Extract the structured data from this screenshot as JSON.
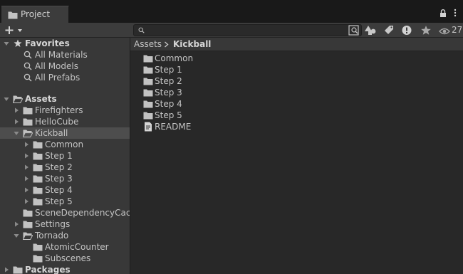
{
  "window": {
    "tab_label": "Project",
    "hidden_count": "27"
  },
  "icons": {
    "tab": "folder-icon",
    "create": "plus-icon",
    "search": "search-icon",
    "scope": "search-scope-icon",
    "type_filter": "shapes-icon",
    "label_filter": "tag-icon",
    "log": "info-icon",
    "favorites": "star-icon",
    "visibility": "eye-icon"
  },
  "colors": {
    "background": "#282828",
    "panel": "#383838",
    "selection": "#4d4d4d",
    "text": "#c4c4c4"
  },
  "tree": [
    {
      "label": "Favorites",
      "bold": true,
      "icon": "star"
    },
    {
      "label": "All Materials",
      "icon": "search"
    },
    {
      "label": "All Models",
      "icon": "search"
    },
    {
      "label": "All Prefabs",
      "icon": "search"
    },
    {
      "label": "Assets",
      "bold": true,
      "icon": "folder-open"
    },
    {
      "label": "Firefighters",
      "icon": "folder"
    },
    {
      "label": "HelloCube",
      "icon": "folder"
    },
    {
      "label": "Kickball",
      "icon": "folder-open",
      "selected": true
    },
    {
      "label": "Common",
      "icon": "folder"
    },
    {
      "label": "Step 1",
      "icon": "folder"
    },
    {
      "label": "Step 2",
      "icon": "folder"
    },
    {
      "label": "Step 3",
      "icon": "folder"
    },
    {
      "label": "Step 4",
      "icon": "folder"
    },
    {
      "label": "Step 5",
      "icon": "folder"
    },
    {
      "label": "SceneDependencyCacl",
      "icon": "folder"
    },
    {
      "label": "Settings",
      "icon": "folder"
    },
    {
      "label": "Tornado",
      "icon": "folder-open"
    },
    {
      "label": "AtomicCounter",
      "icon": "folder"
    },
    {
      "label": "Subscenes",
      "icon": "folder"
    },
    {
      "label": "Packages",
      "bold": true,
      "icon": "folder"
    }
  ],
  "breadcrumb": [
    "Assets",
    "Kickball"
  ],
  "contents": [
    {
      "label": "Common",
      "icon": "folder"
    },
    {
      "label": "Step 1",
      "icon": "folder"
    },
    {
      "label": "Step 2",
      "icon": "folder"
    },
    {
      "label": "Step 3",
      "icon": "folder"
    },
    {
      "label": "Step 4",
      "icon": "folder"
    },
    {
      "label": "Step 5",
      "icon": "folder"
    },
    {
      "label": "README",
      "icon": "document"
    }
  ]
}
